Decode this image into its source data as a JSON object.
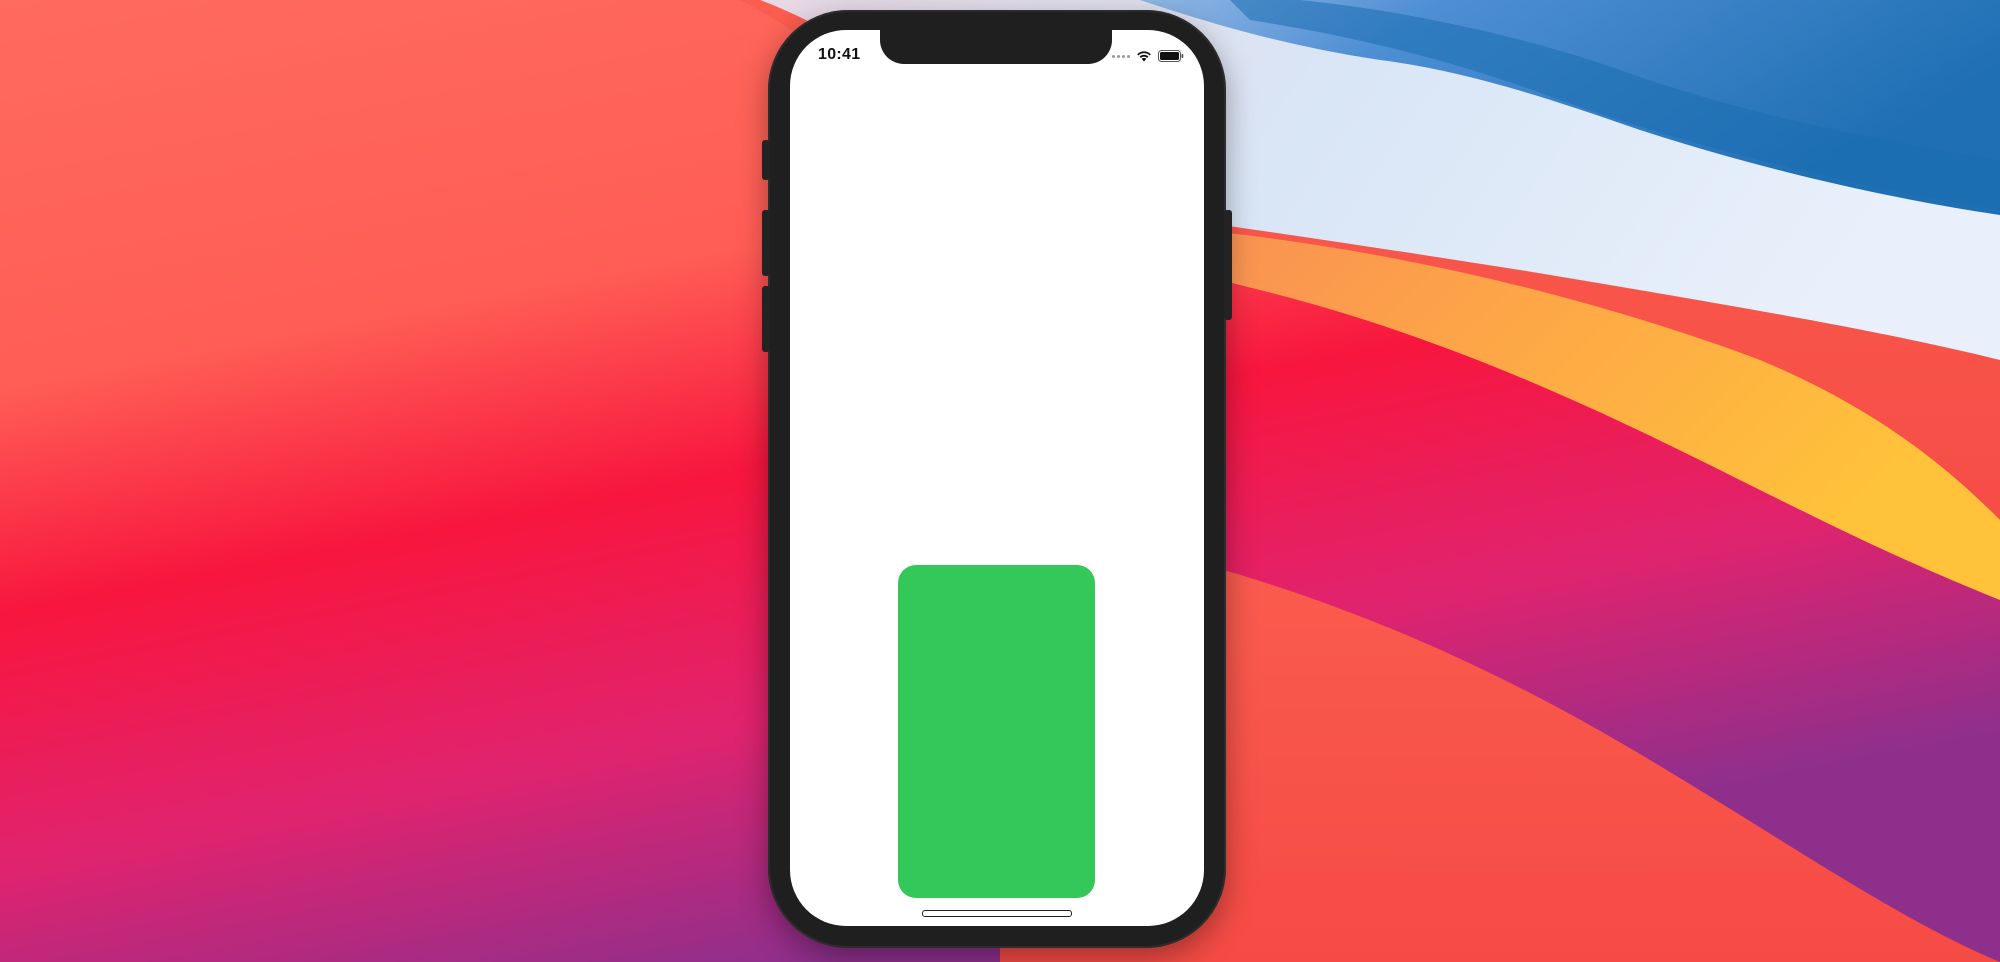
{
  "status_bar": {
    "time": "10:41",
    "wifi_icon": "wifi-icon",
    "battery_icon": "battery-icon",
    "signal_icon": "cellular-signal-icon"
  },
  "content": {
    "card_color": "#34c85a",
    "background_color": "#ffffff"
  },
  "device": {
    "frame_color": "#1f1f1f"
  }
}
